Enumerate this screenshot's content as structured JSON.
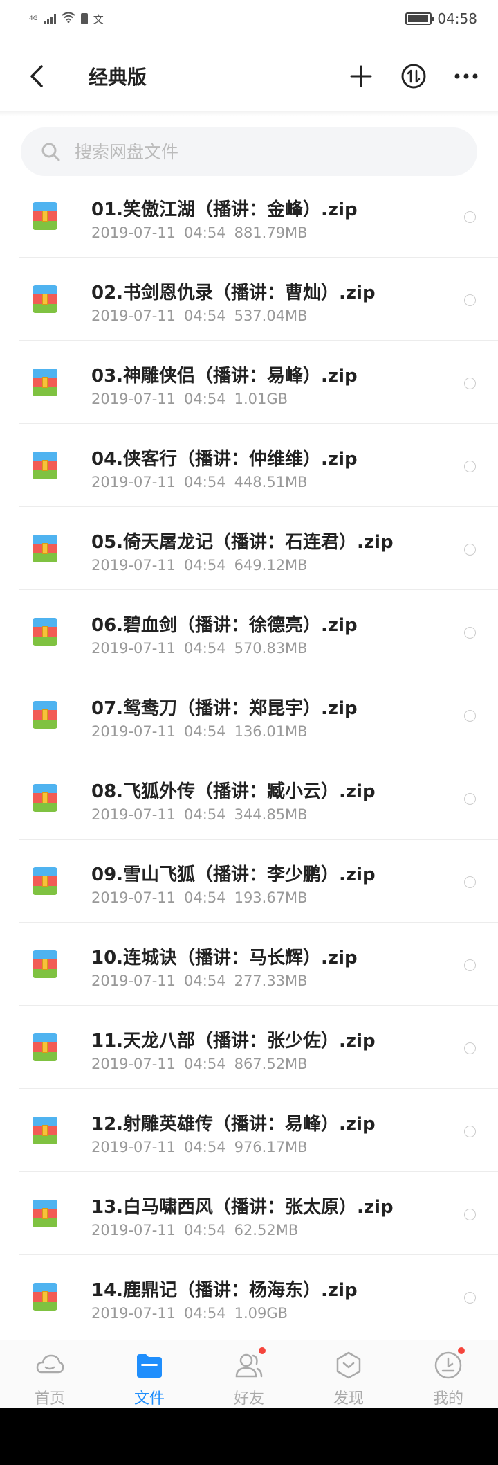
{
  "status_bar": {
    "network": "4G",
    "language_indicator": "文",
    "time": "04:58",
    "battery_level": 0.95
  },
  "header": {
    "title": "经典版",
    "back_icon": "chevron-left-icon",
    "actions": [
      "plus-icon",
      "sort-icon",
      "more-icon"
    ]
  },
  "search": {
    "placeholder": "搜索网盘文件"
  },
  "files": [
    {
      "name": "01.笑傲江湖（播讲：金峰）.zip",
      "date": "2019-07-11",
      "time": "04:54",
      "size": "881.79MB"
    },
    {
      "name": "02.书剑恩仇录（播讲：曹灿）.zip",
      "date": "2019-07-11",
      "time": "04:54",
      "size": "537.04MB"
    },
    {
      "name": "03.神雕侠侣（播讲：易峰）.zip",
      "date": "2019-07-11",
      "time": "04:54",
      "size": "1.01GB"
    },
    {
      "name": "04.侠客行（播讲：仲维维）.zip",
      "date": "2019-07-11",
      "time": "04:54",
      "size": "448.51MB"
    },
    {
      "name": "05.倚天屠龙记（播讲：石连君）.zip",
      "date": "2019-07-11",
      "time": "04:54",
      "size": "649.12MB"
    },
    {
      "name": "06.碧血剑（播讲：徐德亮）.zip",
      "date": "2019-07-11",
      "time": "04:54",
      "size": "570.83MB"
    },
    {
      "name": "07.鸳鸯刀（播讲：郑昆宇）.zip",
      "date": "2019-07-11",
      "time": "04:54",
      "size": "136.01MB"
    },
    {
      "name": "08.飞狐外传（播讲：臧小云）.zip",
      "date": "2019-07-11",
      "time": "04:54",
      "size": "344.85MB"
    },
    {
      "name": "09.雪山飞狐（播讲：李少鹏）.zip",
      "date": "2019-07-11",
      "time": "04:54",
      "size": "193.67MB"
    },
    {
      "name": "10.连城诀（播讲：马长辉）.zip",
      "date": "2019-07-11",
      "time": "04:54",
      "size": "277.33MB"
    },
    {
      "name": "11.天龙八部（播讲：张少佐）.zip",
      "date": "2019-07-11",
      "time": "04:54",
      "size": "867.52MB"
    },
    {
      "name": "12.射雕英雄传（播讲：易峰）.zip",
      "date": "2019-07-11",
      "time": "04:54",
      "size": "976.17MB"
    },
    {
      "name": "13.白马啸西风（播讲：张太原）.zip",
      "date": "2019-07-11",
      "time": "04:54",
      "size": "62.52MB"
    },
    {
      "name": "14.鹿鼎记（播讲：杨海东）.zip",
      "date": "2019-07-11",
      "time": "04:54",
      "size": "1.09GB"
    }
  ],
  "bottom_nav": [
    {
      "label": "首页",
      "icon": "home-cloud-icon",
      "active": false,
      "badge": false
    },
    {
      "label": "文件",
      "icon": "folder-icon",
      "active": true,
      "badge": false
    },
    {
      "label": "好友",
      "icon": "friends-icon",
      "active": false,
      "badge": true
    },
    {
      "label": "发现",
      "icon": "discover-icon",
      "active": false,
      "badge": false
    },
    {
      "label": "我的",
      "icon": "profile-icon",
      "active": false,
      "badge": true
    }
  ],
  "colors": {
    "accent": "#1f8efc",
    "badge": "#f5453c",
    "text_primary": "#222222",
    "text_secondary": "#999999"
  }
}
